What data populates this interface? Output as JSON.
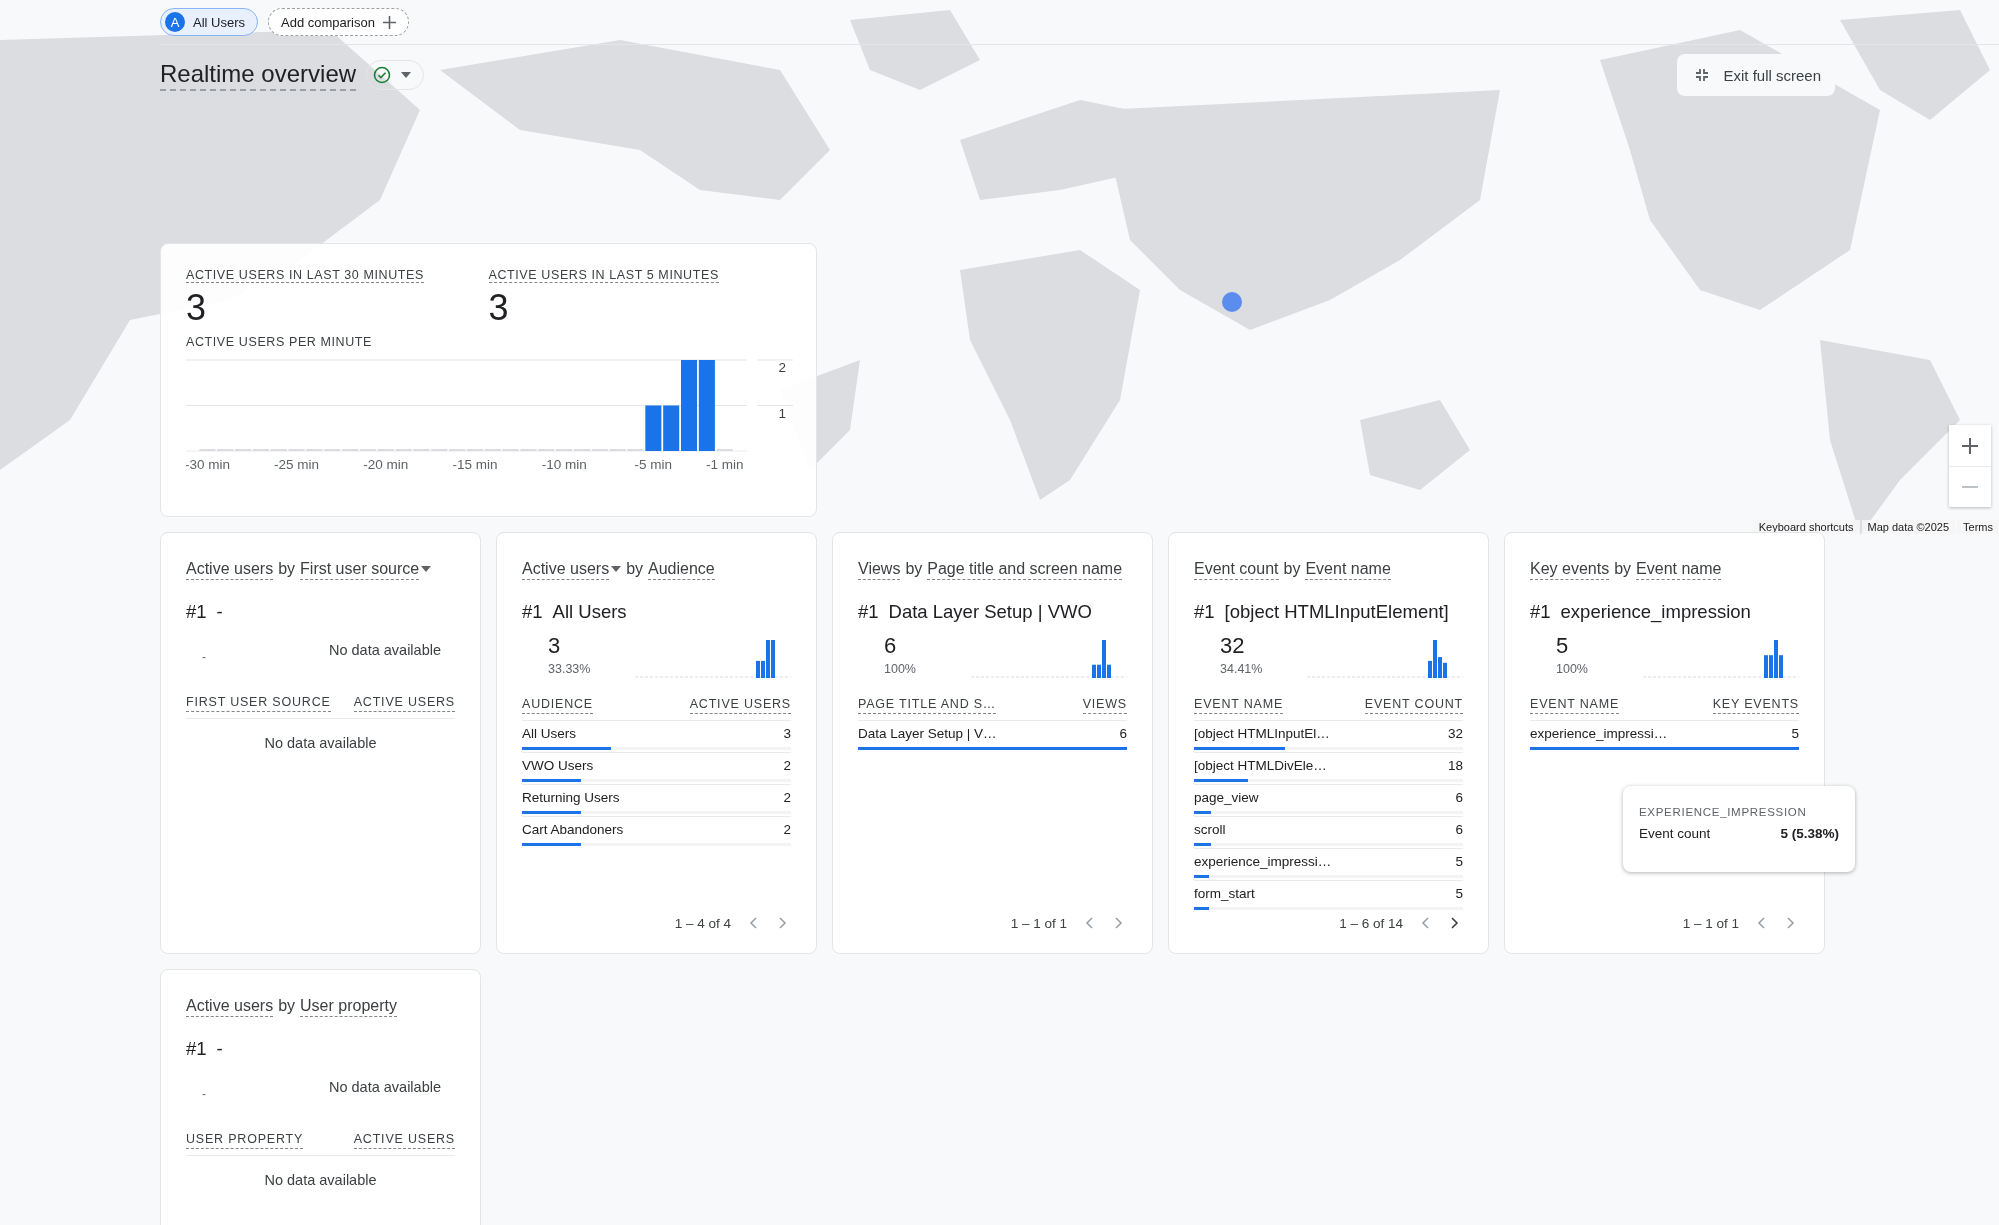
{
  "segment_chip": {
    "badge": "A",
    "label": "All Users"
  },
  "add_comparison": "Add comparison",
  "page_title": "Realtime overview",
  "exit_button": "Exit full screen",
  "map_footer": [
    "Keyboard shortcuts",
    "Map data ©2025",
    "Terms"
  ],
  "overview": {
    "metrics": [
      {
        "label": "ACTIVE USERS IN LAST 30 MINUTES",
        "value": "3"
      },
      {
        "label": "ACTIVE USERS IN LAST 5 MINUTES",
        "value": "3"
      }
    ],
    "chart_title": "ACTIVE USERS PER MINUTE",
    "chart_data": {
      "type": "bar",
      "x": [
        -30,
        -29,
        -28,
        -27,
        -26,
        -25,
        -24,
        -23,
        -22,
        -21,
        -20,
        -19,
        -18,
        -17,
        -16,
        -15,
        -14,
        -13,
        -12,
        -11,
        -10,
        -9,
        -8,
        -7,
        -6,
        -5,
        -4,
        -3,
        -2,
        -1
      ],
      "values": [
        0,
        0,
        0,
        0,
        0,
        0,
        0,
        0,
        0,
        0,
        0,
        0,
        0,
        0,
        0,
        0,
        0,
        0,
        0,
        0,
        0,
        0,
        0,
        0,
        0,
        1,
        1,
        2,
        2,
        0
      ],
      "xlim": [
        -31.2,
        0.25
      ],
      "ylim": [
        0,
        2
      ],
      "yticks": [
        1,
        2
      ],
      "xticks": [
        {
          "value": -30,
          "label": "-30 min"
        },
        {
          "value": -25,
          "label": "-25 min"
        },
        {
          "value": -20,
          "label": "-20 min"
        },
        {
          "value": -15,
          "label": "-15 min"
        },
        {
          "value": -10,
          "label": "-10 min"
        },
        {
          "value": -5,
          "label": "-5 min"
        },
        {
          "value": -1,
          "label": "-1 min"
        }
      ]
    }
  },
  "cards": [
    {
      "metric": "Active users",
      "connector": "by",
      "dimension": "First user source",
      "metric_menu": false,
      "dimension_menu": true,
      "top": {
        "rank": "#1",
        "name": "-",
        "value": "-",
        "note": "No data available"
      },
      "columns": [
        "FIRST USER SOURCE",
        "ACTIVE USERS"
      ],
      "empty_text": "No data available"
    },
    {
      "metric": "Active users",
      "connector": "by",
      "dimension": "Audience",
      "metric_menu": true,
      "dimension_menu": false,
      "top": {
        "rank": "#1",
        "name": "All Users",
        "value": "3",
        "percent": "33.33%"
      },
      "columns": [
        "AUDIENCE",
        "ACTIVE USERS"
      ],
      "rows": [
        {
          "name": "All Users",
          "value": "3",
          "level": 0.33
        },
        {
          "name": "VWO Users",
          "value": "2",
          "level": 0.22
        },
        {
          "name": "Returning Users",
          "value": "2",
          "level": 0.22
        },
        {
          "name": "Cart Abandoners",
          "value": "2",
          "level": 0.22
        }
      ],
      "pagination": {
        "text": "1 – 4 of 4",
        "prev_enabled": false,
        "next_enabled": false
      }
    },
    {
      "metric": "Views",
      "connector": "by",
      "dimension": "Page title and screen name",
      "metric_menu": false,
      "dimension_menu": false,
      "top": {
        "rank": "#1",
        "name": "Data Layer Setup | VWO",
        "value": "6",
        "percent": "100%"
      },
      "columns": [
        "PAGE TITLE AND S…",
        "VIEWS"
      ],
      "rows": [
        {
          "name": "Data Layer Setup | V…",
          "value": "6",
          "level": 1
        }
      ],
      "pagination": {
        "text": "1 – 1 of 1",
        "prev_enabled": false,
        "next_enabled": false
      }
    },
    {
      "metric": "Event count",
      "connector": "by",
      "dimension": "Event name",
      "metric_menu": false,
      "dimension_menu": false,
      "top": {
        "rank": "#1",
        "name": "[object HTMLInputElement]",
        "value": "32",
        "percent": "34.41%"
      },
      "columns": [
        "EVENT NAME",
        "EVENT COUNT"
      ],
      "rows": [
        {
          "name": "[object HTMLInputEl…",
          "value": "32",
          "level": 0.34
        },
        {
          "name": "[object HTMLDivEle…",
          "value": "18",
          "level": 0.2
        },
        {
          "name": "page_view",
          "value": "6",
          "level": 0.065
        },
        {
          "name": "scroll",
          "value": "6",
          "level": 0.065
        },
        {
          "name": "experience_impressi…",
          "value": "5",
          "level": 0.055
        },
        {
          "name": "form_start",
          "value": "5",
          "level": 0.055
        }
      ],
      "pagination": {
        "text": "1 – 6 of 14",
        "prev_enabled": false,
        "next_enabled": true
      }
    },
    {
      "metric": "Key events",
      "connector": "by",
      "dimension": "Event name",
      "metric_menu": false,
      "dimension_menu": false,
      "top": {
        "rank": "#1",
        "name": "experience_impression",
        "value": "5",
        "percent": "100%"
      },
      "columns": [
        "EVENT NAME",
        "KEY EVENTS"
      ],
      "rows": [
        {
          "name": "experience_impressi…",
          "value": "5",
          "level": 1
        }
      ],
      "pagination": {
        "text": "1 – 1 of 1",
        "prev_enabled": false,
        "next_enabled": false
      },
      "tooltip": {
        "title": "EXPERIENCE_IMPRESSION",
        "label": "Event count",
        "value": "5 (5.38%)"
      }
    },
    {
      "metric": "Active users",
      "connector": "by",
      "dimension": "User property",
      "metric_menu": false,
      "dimension_menu": false,
      "top": {
        "rank": "#1",
        "name": "-",
        "value": "-",
        "note": "No data available"
      },
      "columns": [
        "USER PROPERTY",
        "ACTIVE USERS"
      ],
      "empty_text": "No data available"
    }
  ]
}
